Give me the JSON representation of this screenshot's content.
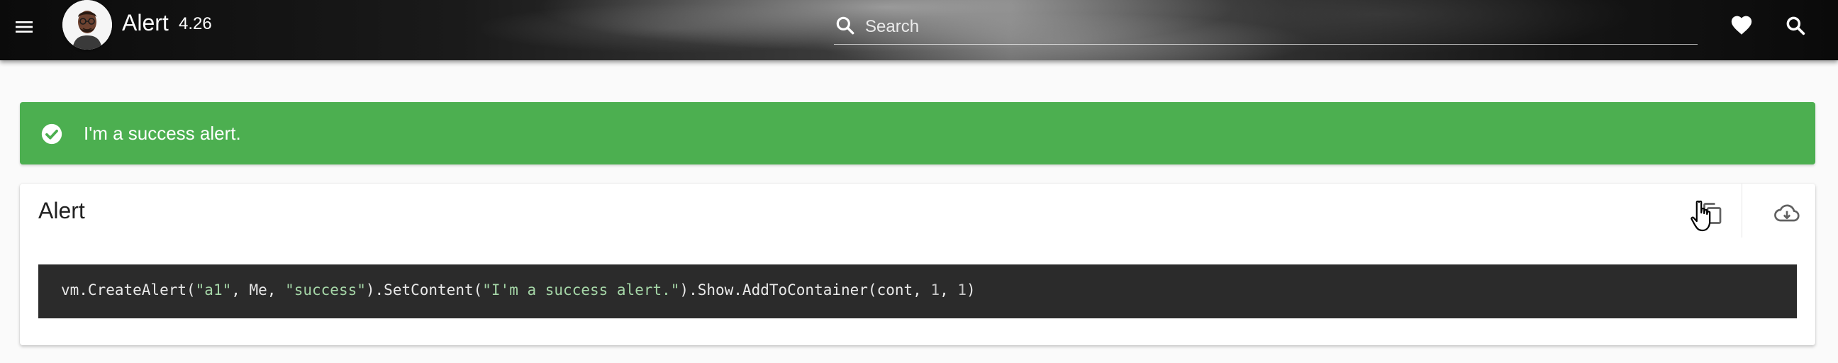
{
  "header": {
    "title": "Alert",
    "version": "4.26",
    "search": {
      "placeholder": "Search",
      "value": ""
    },
    "icons": {
      "menu": "menu-icon",
      "search_field": "search-icon",
      "favorite": "heart-icon",
      "search_button": "search-icon"
    }
  },
  "alert": {
    "type": "success",
    "message": "I'm a success alert.",
    "icon": "check-circle-icon",
    "color": "#4caf50"
  },
  "card": {
    "title": "Alert",
    "actions": {
      "copy_icon": "copy-icon",
      "download_icon": "cloud-download-icon"
    },
    "code": {
      "t1": "vm.CreateAlert(",
      "s1": "\"a1\"",
      "t2": ", Me, ",
      "s2": "\"success\"",
      "t3": ").SetContent(",
      "s3": "\"I'm a success alert.\"",
      "t4": ").Show.AddToContainer(cont, ",
      "n1": "1",
      "t5": ", ",
      "n2": "1",
      "t6": ")"
    },
    "code_bg": "#2b2b2b",
    "string_color": "#a5d6a7"
  }
}
